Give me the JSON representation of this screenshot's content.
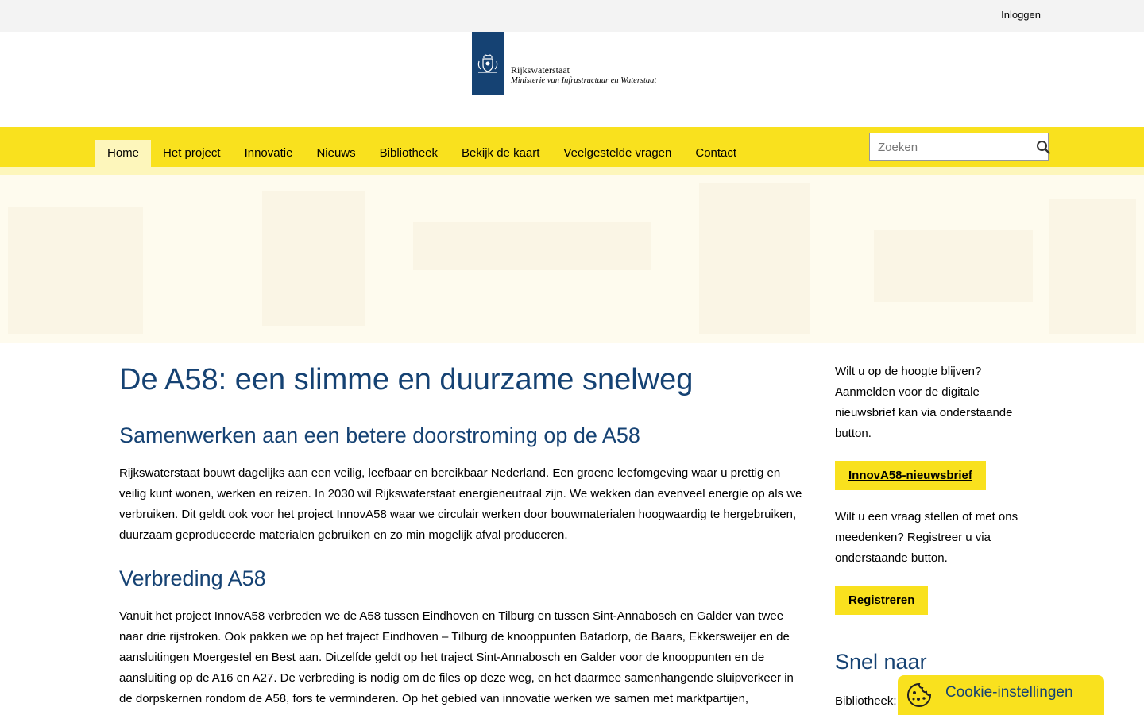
{
  "topbar": {
    "login": "Inloggen"
  },
  "logo": {
    "line1": "Rijkswaterstaat",
    "line2": "Ministerie van Infrastructuur en Waterstaat",
    "icon": "crest-icon"
  },
  "nav": {
    "items": [
      {
        "label": "Home",
        "active": true
      },
      {
        "label": "Het project"
      },
      {
        "label": "Innovatie"
      },
      {
        "label": "Nieuws"
      },
      {
        "label": "Bibliotheek"
      },
      {
        "label": "Bekijk de kaart"
      },
      {
        "label": "Veelgestelde vragen"
      },
      {
        "label": "Contact"
      }
    ]
  },
  "search": {
    "placeholder": "Zoeken",
    "icon": "search-icon"
  },
  "main": {
    "title": "De A58: een slimme en duurzame snelweg",
    "section1_heading": "Samenwerken aan een betere doorstroming op de A58",
    "section1_text": "Rijkswaterstaat bouwt dagelijks aan een veilig, leefbaar en bereikbaar Nederland. Een groene leefomgeving waar u prettig en veilig kunt wonen, werken en reizen. In 2030 wil Rijkswaterstaat energieneutraal zijn. We wekken dan evenveel energie op als we verbruiken. Dit geldt ook voor het project InnovA58 waar we circulair werken door bouwmaterialen hoogwaardig te hergebruiken, duurzaam geproduceerde materialen gebruiken en zo min mogelijk afval produceren.",
    "section2_heading": "Verbreding A58",
    "section2_text": "Vanuit het project InnovA58 verbreden we de A58 tussen Eindhoven en Tilburg en tussen Sint-Annabosch en Galder van twee naar drie rijstroken. Ook pakken we op het traject Eindhoven – Tilburg de knooppunten Batadorp, de Baars, Ekkersweijer en de aansluitingen Moergestel en Best aan. Ditzelfde geldt op het traject Sint-Annabosch en Galder voor de knooppunten en de aansluiting op de A16 en A27. De verbreding is nodig om de files op deze weg, en het daarmee samenhangende sluipverkeer in de dorpskernen rondom de A58, fors te verminderen. Op het gebied van innovatie werken we samen met marktpartijen,"
  },
  "sidebar": {
    "newsletter_text": "Wilt u op de hoogte blijven? Aanmelden voor de digitale nieuwsbrief kan via onderstaande button.",
    "newsletter_button": "InnovA58-nieuwsbrief",
    "register_text": "Wilt u een vraag stellen of met ons meedenken? Registreer u via onderstaande button.",
    "register_button": "Registreren",
    "snel_heading": "Snel naar",
    "snel_first": "Bibliotheek:"
  },
  "cookie": {
    "label": "Cookie-instellingen",
    "icon": "cookie-icon"
  },
  "colors": {
    "brand_yellow": "#f9e11e",
    "brand_blue": "#154273",
    "nav_active": "#fdf6bb"
  }
}
